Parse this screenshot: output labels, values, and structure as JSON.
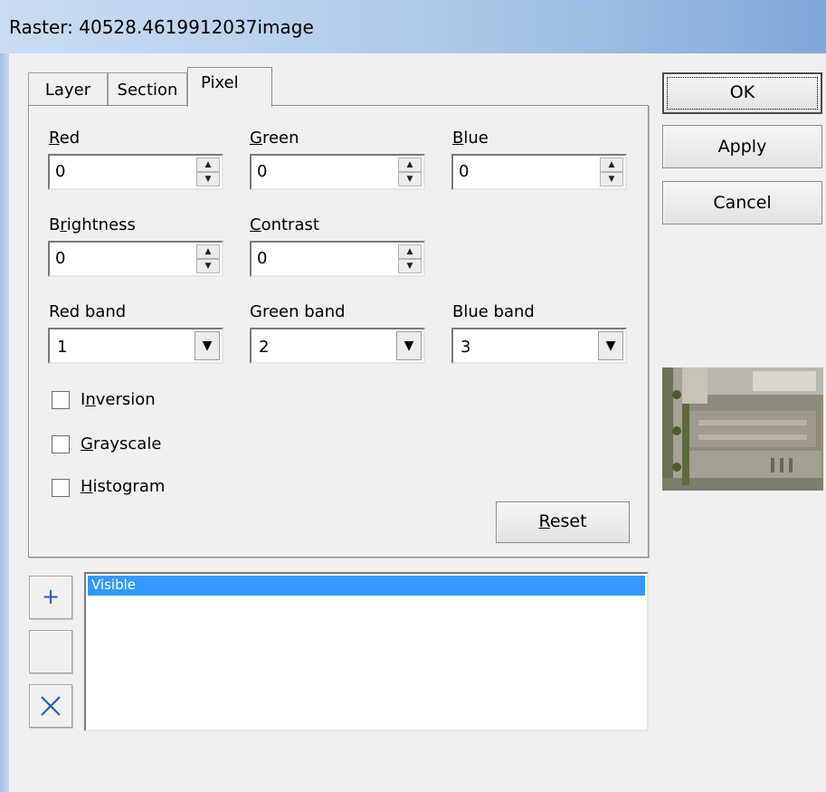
{
  "window": {
    "title": "Raster: 40528.4619912037image"
  },
  "tabs": [
    {
      "label": "Layer",
      "active": false
    },
    {
      "label": "Section",
      "active": false
    },
    {
      "label": "Pixel",
      "active": true
    }
  ],
  "pixel": {
    "red": {
      "label": "Red",
      "value": "0"
    },
    "green": {
      "label": "Green",
      "value": "0"
    },
    "blue": {
      "label": "Blue",
      "value": "0"
    },
    "brightness": {
      "label": "Brightness",
      "value": "0"
    },
    "contrast": {
      "label": "Contrast",
      "value": "0"
    },
    "red_band": {
      "label": "Red band",
      "value": "1"
    },
    "green_band": {
      "label": "Green band",
      "value": "2"
    },
    "blue_band": {
      "label": "Blue band",
      "value": "3"
    },
    "inversion": {
      "label": "Inversion",
      "checked": false
    },
    "grayscale": {
      "label": "Grayscale",
      "checked": false
    },
    "histogram": {
      "label": "Histogram",
      "checked": false
    },
    "reset_label": "Reset"
  },
  "buttons": {
    "ok": "OK",
    "apply": "Apply",
    "cancel": "Cancel"
  },
  "list": {
    "items": [
      "Visible"
    ]
  },
  "icons": {
    "add": "plus-icon",
    "blank": "blank-button",
    "delete": "x-icon"
  },
  "colors": {
    "selection": "#3399ff",
    "titlebar": "#b7cfec"
  }
}
